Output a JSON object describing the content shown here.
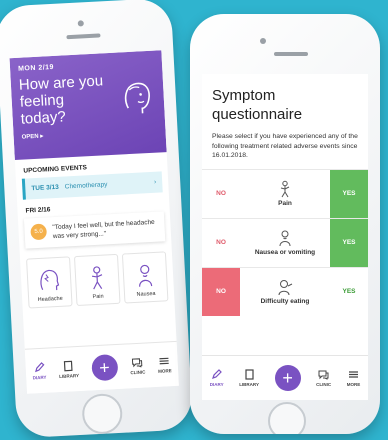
{
  "colors": {
    "background": "#2fb4cf",
    "brand_purple": "#7a52c2",
    "event_blue": "#2a8fb0",
    "yes_green": "#62bb5d",
    "no_red": "#ec6b78",
    "mood_orange": "#f5b14c"
  },
  "diary_screen": {
    "date": "MON 2/19",
    "question": "How are you feeling today?",
    "open_label": "OPEN ▸",
    "upcoming_header": "UPCOMING EVENTS",
    "event": {
      "date": "TUE 3/13",
      "name": "Chemotherapy",
      "arrow": "›"
    },
    "day_header": "FRI 2/16",
    "entry": {
      "mood_score": "5.0",
      "quote": "\"Today I feel well, but the headache was very strong...\""
    },
    "symptom_cards": [
      {
        "label": "Headache",
        "icon": "headache-icon"
      },
      {
        "label": "Pain",
        "icon": "pain-icon"
      },
      {
        "label": "Nausea",
        "icon": "nausea-icon"
      }
    ],
    "tabbar": {
      "diary": "DIARY",
      "library": "LIBRARY",
      "add": "+",
      "clinic": "CLINIC",
      "more": "MORE"
    }
  },
  "questionnaire_screen": {
    "title": "Symptom questionnaire",
    "intro": "Please select if you have experienced any of the following treatment related adverse events since 16.01.2018.",
    "rows": [
      {
        "label": "Pain",
        "no": "NO",
        "yes": "YES",
        "selected": "yes",
        "icon": "pain-icon"
      },
      {
        "label": "Nausea or vomiting",
        "no": "NO",
        "yes": "YES",
        "selected": "yes",
        "icon": "nausea-icon"
      },
      {
        "label": "Difficulty eating",
        "no": "NO",
        "yes": "YES",
        "selected": "no",
        "icon": "difficulty-eating-icon"
      }
    ],
    "tabbar": {
      "diary": "DIARY",
      "library": "LIBRARY",
      "add": "+",
      "clinic": "CLINIC",
      "more": "MORE"
    }
  }
}
